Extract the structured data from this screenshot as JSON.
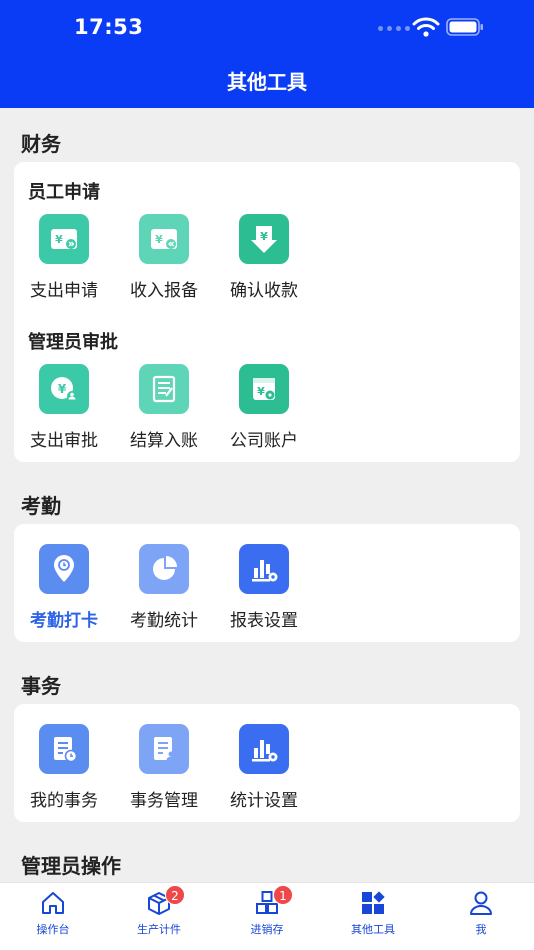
{
  "status_bar": {
    "time": "17:53"
  },
  "nav": {
    "title": "其他工具"
  },
  "sections": {
    "finance": {
      "title": "财务",
      "groups": [
        {
          "title": "员工申请",
          "items": [
            "支出申请",
            "收入报备",
            "确认收款"
          ]
        },
        {
          "title": "管理员审批",
          "items": [
            "支出审批",
            "结算入账",
            "公司账户"
          ]
        }
      ]
    },
    "attendance": {
      "title": "考勤",
      "items": [
        "考勤打卡",
        "考勤统计",
        "报表设置"
      ]
    },
    "affairs": {
      "title": "事务",
      "items": [
        "我的事务",
        "事务管理",
        "统计设置"
      ]
    },
    "admin": {
      "title": "管理员操作"
    }
  },
  "tabbar": {
    "items": [
      {
        "label": "操作台",
        "icon": "home-icon"
      },
      {
        "label": "生产计件",
        "icon": "box-icon",
        "badge": "2"
      },
      {
        "label": "进销存",
        "icon": "grid-icon",
        "badge": "1"
      },
      {
        "label": "其他工具",
        "icon": "apps-icon",
        "active": true
      },
      {
        "label": "我",
        "icon": "user-icon"
      }
    ]
  },
  "colors": {
    "header": "#0a3cf5",
    "active_text": "#2d63e8",
    "badge": "#ef4848",
    "teal": "#3cc9a8",
    "blue": "#5b8cf0"
  }
}
